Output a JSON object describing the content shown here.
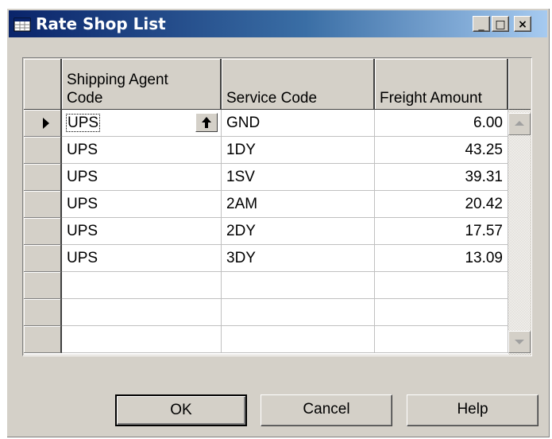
{
  "window": {
    "title": "Rate Shop List",
    "minimize": "_",
    "maximize": "□",
    "close": "×"
  },
  "table": {
    "columns": [
      "Shipping Agent Code",
      "Service Code",
      "Freight Amount"
    ],
    "column_lines": [
      [
        "Shipping Agent",
        "Code"
      ],
      [
        "Service Code"
      ],
      [
        "Freight Amount"
      ]
    ],
    "rows": [
      {
        "agent": "UPS",
        "service": "GND",
        "amount": "6.00"
      },
      {
        "agent": "UPS",
        "service": "1DY",
        "amount": "43.25"
      },
      {
        "agent": "UPS",
        "service": "1SV",
        "amount": "39.31"
      },
      {
        "agent": "UPS",
        "service": "2AM",
        "amount": "20.42"
      },
      {
        "agent": "UPS",
        "service": "2DY",
        "amount": "17.57"
      },
      {
        "agent": "UPS",
        "service": "3DY",
        "amount": "13.09"
      },
      {
        "agent": "",
        "service": "",
        "amount": ""
      },
      {
        "agent": "",
        "service": "",
        "amount": ""
      },
      {
        "agent": "",
        "service": "",
        "amount": ""
      }
    ],
    "selected_row": 0
  },
  "buttons": {
    "ok": "OK",
    "cancel": "Cancel",
    "help": "Help"
  },
  "icons": {
    "app": "table-icon",
    "lookup": "lookup-arrow-up-icon",
    "row_marker": "current-row-triangle-icon"
  }
}
